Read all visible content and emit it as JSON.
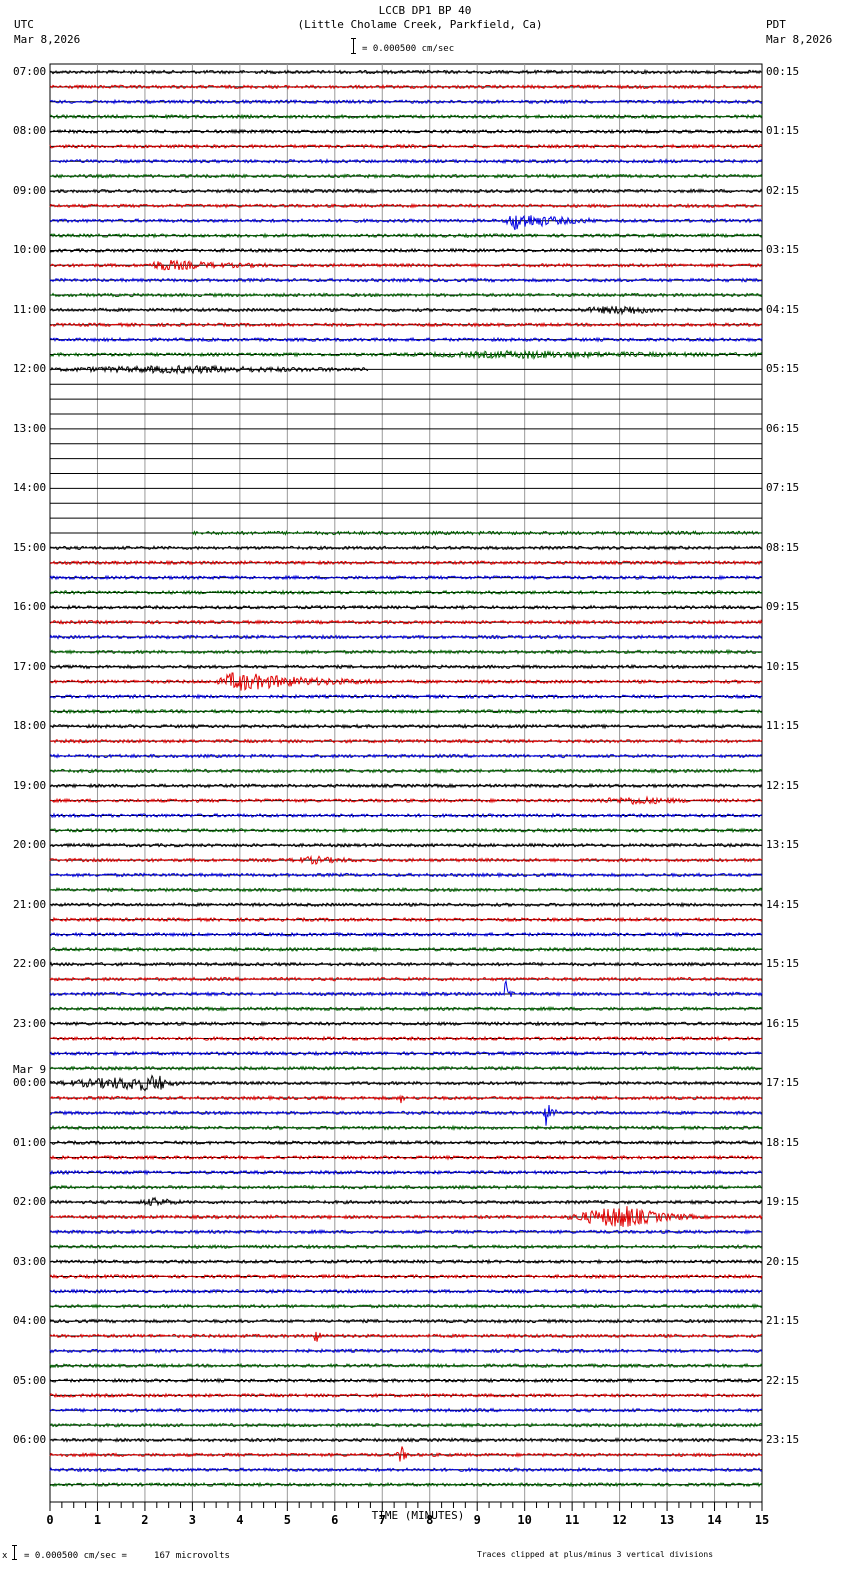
{
  "header": {
    "title": "LCCB DP1 BP 40",
    "subtitle": "(Little Cholame Creek, Parkfield, Ca)",
    "left_tz": "UTC",
    "left_date": "Mar 8,2026",
    "right_tz": "PDT",
    "right_date": "Mar 8,2026",
    "scale": "= 0.000500 cm/sec"
  },
  "footer": {
    "scale": "= 0.000500 cm/sec =     167 microvolts",
    "scale_prefix": "x",
    "clip_note": "Traces clipped at plus/minus 3 vertical divisions"
  },
  "chart_data": {
    "type": "line",
    "title": "LCCB DP1 BP 40",
    "xlabel": "TIME (MINUTES)",
    "xlim": [
      0,
      15
    ],
    "x_ticks": [
      "0",
      "1",
      "2",
      "3",
      "4",
      "5",
      "6",
      "7",
      "8",
      "9",
      "10",
      "11",
      "12",
      "13",
      "14",
      "15"
    ],
    "grid": true,
    "rows": 96,
    "row_minutes": 15,
    "trace_colors": [
      "#000000",
      "#e00000",
      "#0000e0",
      "#006400"
    ],
    "left_labels": [
      "07:00",
      "08:00",
      "09:00",
      "10:00",
      "11:00",
      "12:00",
      "13:00",
      "14:00",
      "15:00",
      "16:00",
      "17:00",
      "18:00",
      "19:00",
      "20:00",
      "21:00",
      "22:00",
      "23:00",
      "00:00",
      "01:00",
      "02:00",
      "03:00",
      "04:00",
      "05:00",
      "06:00"
    ],
    "left_day_marker": {
      "label": "Mar 9",
      "before_hour_index": 17
    },
    "right_labels": [
      "00:15",
      "01:15",
      "02:15",
      "03:15",
      "04:15",
      "05:15",
      "06:15",
      "07:15",
      "08:15",
      "09:15",
      "10:15",
      "11:15",
      "12:15",
      "13:15",
      "14:15",
      "15:15",
      "16:15",
      "17:15",
      "18:15",
      "19:15",
      "20:15",
      "21:15",
      "22:15",
      "23:15"
    ],
    "data_gap": {
      "from_row": 20,
      "from_minute": 6.7,
      "to_row": 31,
      "to_minute": 3.0
    },
    "events": [
      {
        "row": 10,
        "start": 9.6,
        "peak": 9.75,
        "end": 11.5,
        "amp": 5
      },
      {
        "row": 13,
        "start": 2.0,
        "peak": 2.4,
        "end": 4.6,
        "amp": 2.5
      },
      {
        "row": 16,
        "start": 11.0,
        "peak": 12.2,
        "end": 13.2,
        "amp": 2
      },
      {
        "row": 19,
        "start": 7.5,
        "peak": 10,
        "end": 15,
        "amp": 1.5
      },
      {
        "row": 20,
        "start": 0,
        "peak": 3,
        "end": 6.7,
        "amp": 1.5
      },
      {
        "row": 41,
        "start": 3.5,
        "peak": 3.9,
        "end": 7.0,
        "amp": 5
      },
      {
        "row": 49,
        "start": 11.2,
        "peak": 12.5,
        "end": 13.6,
        "amp": 1.5
      },
      {
        "row": 53,
        "start": 5.0,
        "peak": 5.6,
        "end": 6.6,
        "amp": 1.5
      },
      {
        "row": 62,
        "start": 9.55,
        "peak": 9.6,
        "end": 9.8,
        "amp": 7
      },
      {
        "row": 68,
        "start": 0,
        "peak": 2.3,
        "end": 2.7,
        "amp": 4
      },
      {
        "row": 69,
        "start": 7.35,
        "peak": 7.4,
        "end": 7.5,
        "amp": 3
      },
      {
        "row": 70,
        "start": 10.4,
        "peak": 10.45,
        "end": 10.7,
        "amp": 7
      },
      {
        "row": 76,
        "start": 1.8,
        "peak": 2.3,
        "end": 2.8,
        "amp": 2
      },
      {
        "row": 77,
        "start": 10.8,
        "peak": 12.1,
        "end": 13.6,
        "amp": 6
      },
      {
        "row": 85,
        "start": 5.55,
        "peak": 5.6,
        "end": 5.75,
        "amp": 4
      },
      {
        "row": 93,
        "start": 7.3,
        "peak": 7.4,
        "end": 7.6,
        "amp": 5
      }
    ]
  }
}
